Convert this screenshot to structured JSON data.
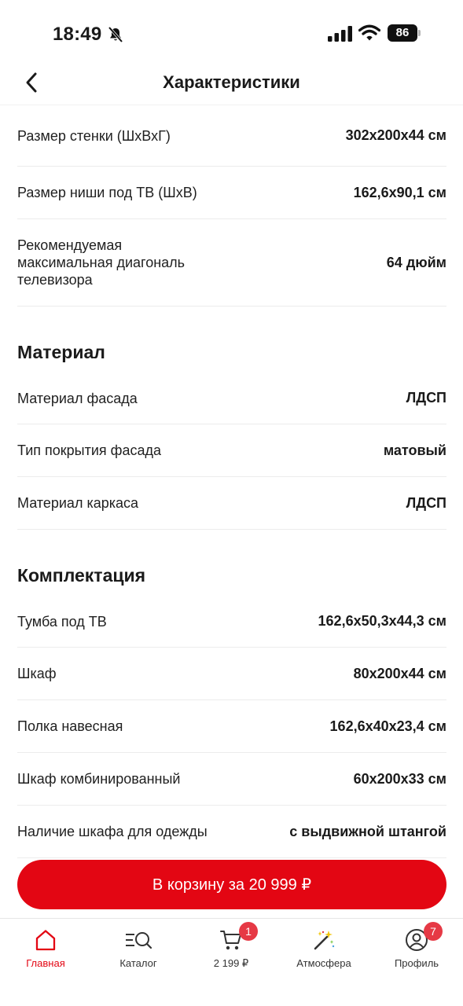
{
  "status_bar": {
    "time": "18:49",
    "battery": "86"
  },
  "header": {
    "title": "Характеристики"
  },
  "dimensions": [
    {
      "label": "Размер стенки (ШхВхГ)",
      "value": "302x200x44 см"
    },
    {
      "label": "Размер ниши под ТВ (ШхВ)",
      "value": "162,6x90,1 см"
    },
    {
      "label": "Рекомендуемая максимальная диагональ телевизора",
      "value": "64 дюйм"
    }
  ],
  "material": {
    "title": "Материал",
    "rows": [
      {
        "label": "Материал фасада",
        "value": "ЛДСП"
      },
      {
        "label": "Тип покрытия фасада",
        "value": "матовый"
      },
      {
        "label": "Материал каркаса",
        "value": "ЛДСП"
      }
    ]
  },
  "kit": {
    "title": "Комплектация",
    "rows": [
      {
        "label": "Тумба под ТВ",
        "value": "162,6x50,3x44,3 см"
      },
      {
        "label": "Шкаф",
        "value": "80x200x44 см"
      },
      {
        "label": "Полка навесная",
        "value": "162,6x40x23,4 см"
      },
      {
        "label": "Шкаф комбинированный",
        "value": "60x200x33 см"
      },
      {
        "label": "Наличие шкафа для одежды",
        "value": "с выдвижной штангой"
      }
    ]
  },
  "cart_button": {
    "label": "В корзину за 20 999 ₽"
  },
  "tabs": [
    {
      "label": "Главная",
      "icon": "home-icon"
    },
    {
      "label": "Каталог",
      "icon": "catalog-search-icon"
    },
    {
      "label": "2 199 ₽",
      "icon": "cart-icon",
      "badge": "1"
    },
    {
      "label": "Атмосфера",
      "icon": "magic-wand-icon"
    },
    {
      "label": "Профиль",
      "icon": "profile-icon",
      "badge": "7"
    }
  ],
  "colors": {
    "accent": "#e30613",
    "badge": "#e63945",
    "divider": "#ececec"
  }
}
